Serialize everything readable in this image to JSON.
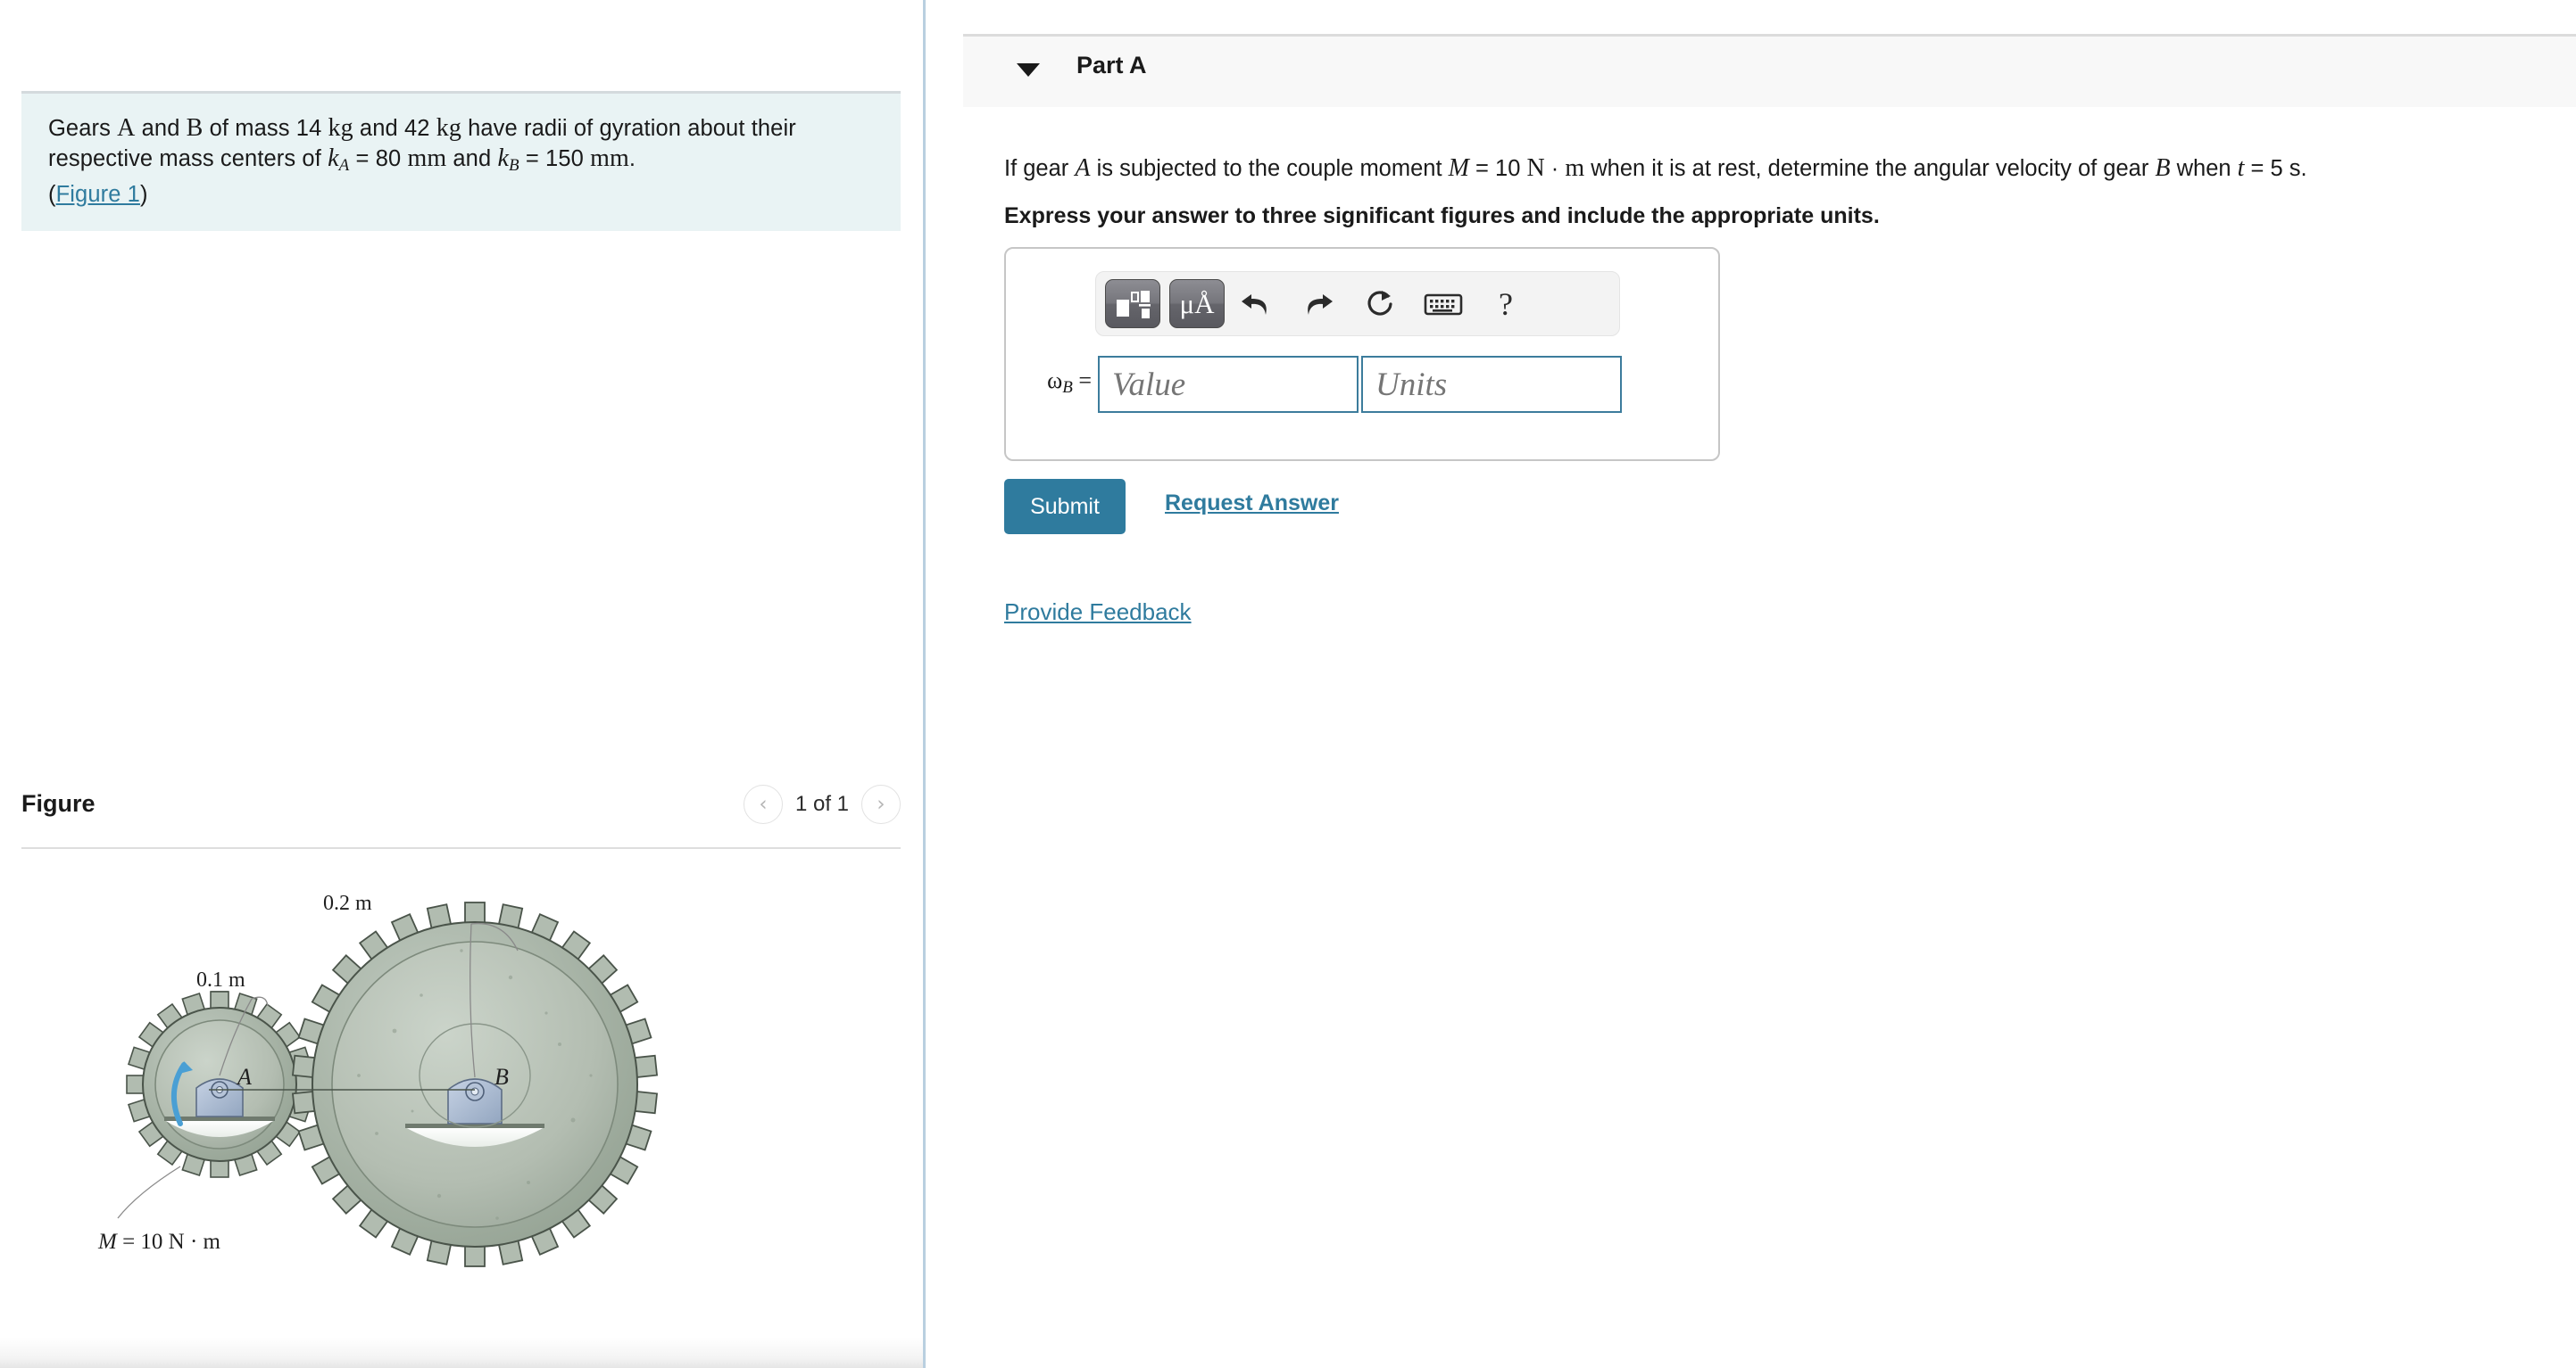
{
  "left": {
    "statement": {
      "line1_a": "Gears ",
      "var_A": "A",
      "line1_b": " and ",
      "var_B": "B",
      "line1_c": " of mass 14 ",
      "unit_kg1": "kg",
      "line1_d": " and 42 ",
      "unit_kg2": "kg",
      "line1_e": " have radii of gyration about their respective mass centers of ",
      "var_k1": "k",
      "sub_A": "A",
      "eq1": " = 80 ",
      "unit_mm1": "mm",
      "line2_and": " and ",
      "var_k2": "k",
      "sub_B": "B",
      "eq2": " = 150 ",
      "unit_mm2": "mm",
      "period": ".",
      "paren_open": "(",
      "figure_link": "Figure 1",
      "paren_close": ")"
    },
    "figure": {
      "title": "Figure",
      "prev_label": "‹",
      "next_label": "›",
      "pager_label": "1 of 1",
      "annotations": {
        "gear_a_radius": "0.1 m",
        "gear_b_radius": "0.2 m",
        "gear_a_label": "A",
        "gear_b_label": "B",
        "moment_label_M": "M",
        "moment_label_rest": " = 10 N · m"
      }
    }
  },
  "right": {
    "part_a": {
      "title": "Part A",
      "caret": "collapse-caret"
    },
    "question": {
      "t1": "If gear ",
      "var_A": "A",
      "t2": " is subjected to the couple moment ",
      "var_M": "M",
      "t3": " = 10 ",
      "unit_N": "N",
      "t4": " · ",
      "unit_m": "m",
      "t5": " when it is at rest, determine the angular velocity of gear ",
      "var_B": "B",
      "t6": " when ",
      "var_t": "t",
      "t7": " = 5 s.",
      "express_note": "Express your answer to three significant figures and include the appropriate units."
    },
    "toolbar": {
      "template_icon": "math-template-icon",
      "units_icon": "μÅ",
      "undo_icon": "↶",
      "redo_icon": "↷",
      "reset_icon": "↻",
      "keyboard_icon": "keyboard-icon",
      "help_icon": "?"
    },
    "answer": {
      "omega_label": "ω",
      "omega_sub": "B",
      "omega_eq": " =",
      "value_placeholder": "Value",
      "value_current": "",
      "units_placeholder": "Units",
      "units_current": ""
    },
    "actions": {
      "submit_label": "Submit",
      "request_answer_label": "Request Answer",
      "provide_feedback_label": "Provide Feedback"
    }
  },
  "colors": {
    "accent": "#2f7b9e",
    "statement_bg": "#e9f3f4",
    "header_bg": "#f8f8f8",
    "input_border": "#3c7c9c",
    "divider": "#b9cfe0"
  }
}
